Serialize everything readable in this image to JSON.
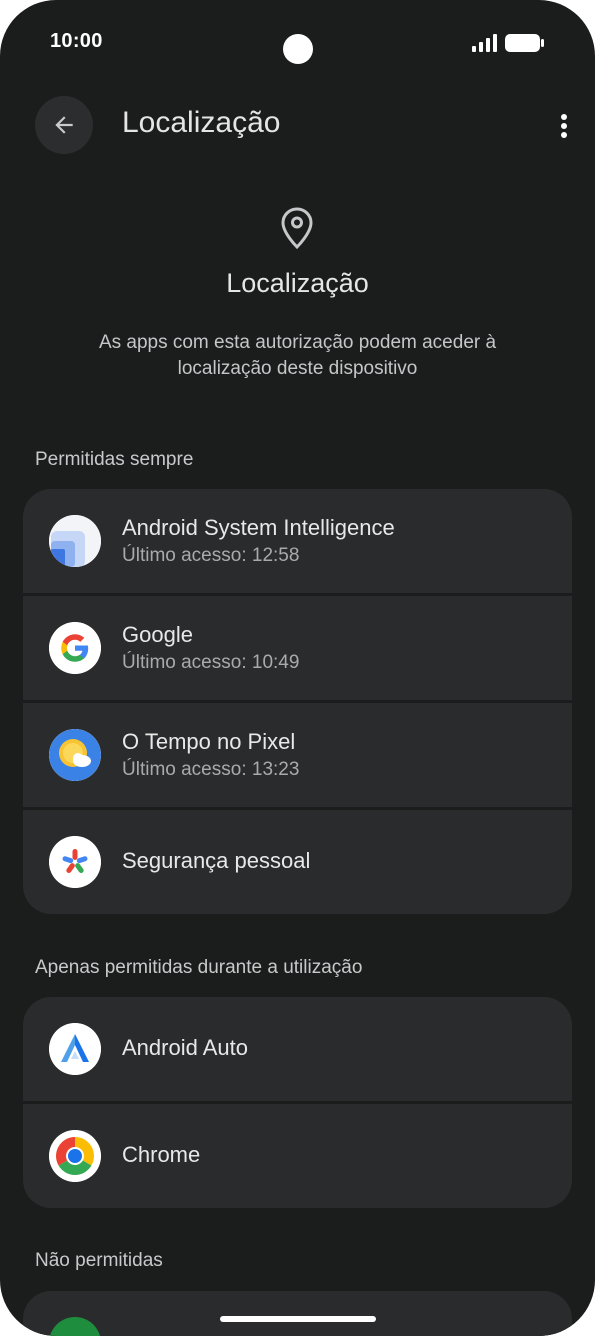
{
  "status_bar": {
    "time": "10:00"
  },
  "app_bar": {
    "title": "Localização"
  },
  "hero": {
    "title": "Localização",
    "description": "As apps com esta autorização podem aceder à localização deste dispositivo"
  },
  "sections": [
    {
      "header": "Permitidas sempre",
      "apps": [
        {
          "name": "Android System Intelligence",
          "subtitle": "Último acesso: 12:58",
          "icon": "android-system-intelligence-icon"
        },
        {
          "name": "Google",
          "subtitle": "Último acesso: 10:49",
          "icon": "google-icon"
        },
        {
          "name": "O Tempo no Pixel",
          "subtitle": "Último acesso: 13:23",
          "icon": "weather-icon"
        },
        {
          "name": "Segurança pessoal",
          "subtitle": "",
          "icon": "personal-safety-icon"
        }
      ]
    },
    {
      "header": "Apenas permitidas durante a utilização",
      "apps": [
        {
          "name": "Android Auto",
          "subtitle": "",
          "icon": "android-auto-icon"
        },
        {
          "name": "Chrome",
          "subtitle": "",
          "icon": "chrome-icon"
        }
      ]
    },
    {
      "header": "Não permitidas",
      "apps": []
    }
  ],
  "colors": {
    "background": "#1b1c1c",
    "card": "#2a2b2c",
    "text_primary": "#e8e8e8",
    "text_secondary": "#a9aaac"
  }
}
